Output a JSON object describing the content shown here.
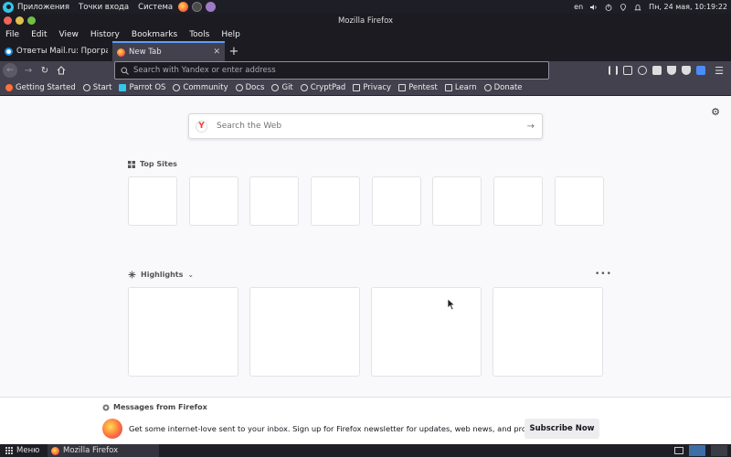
{
  "system_panel": {
    "apps_label": "Приложения",
    "places_label": "Точки входа",
    "system_label": "Система",
    "keyboard_layout": "en",
    "datetime": "Пн, 24 мая, 10:19:22"
  },
  "window": {
    "title": "Mozilla Firefox"
  },
  "menubar": [
    "File",
    "Edit",
    "View",
    "History",
    "Bookmarks",
    "Tools",
    "Help"
  ],
  "tabs": [
    {
      "label": "Ответы Mail.ru: Програг",
      "active": false
    },
    {
      "label": "New Tab",
      "active": true
    }
  ],
  "urlbar": {
    "placeholder": "Search with Yandex or enter address"
  },
  "bookmarks": [
    "Getting Started",
    "Start",
    "Parrot OS",
    "Community",
    "Docs",
    "Git",
    "CryptPad",
    "Privacy",
    "Pentest",
    "Learn",
    "Donate"
  ],
  "newtab": {
    "search_placeholder": "Search the Web",
    "top_sites_title": "Top Sites",
    "highlights_title": "Highlights"
  },
  "messages": {
    "title": "Messages from Firefox",
    "text": "Get some internet-love sent to your inbox. Sign up for Firefox newsletter for updates, web news, and pro-tips.",
    "button": "Subscribe Now"
  },
  "taskbar": {
    "menu_label": "Меню",
    "task_label": "Mozilla Firefox"
  },
  "colors": {
    "accent": "#5e9bf7",
    "firefox_orange": "#ff7139"
  }
}
